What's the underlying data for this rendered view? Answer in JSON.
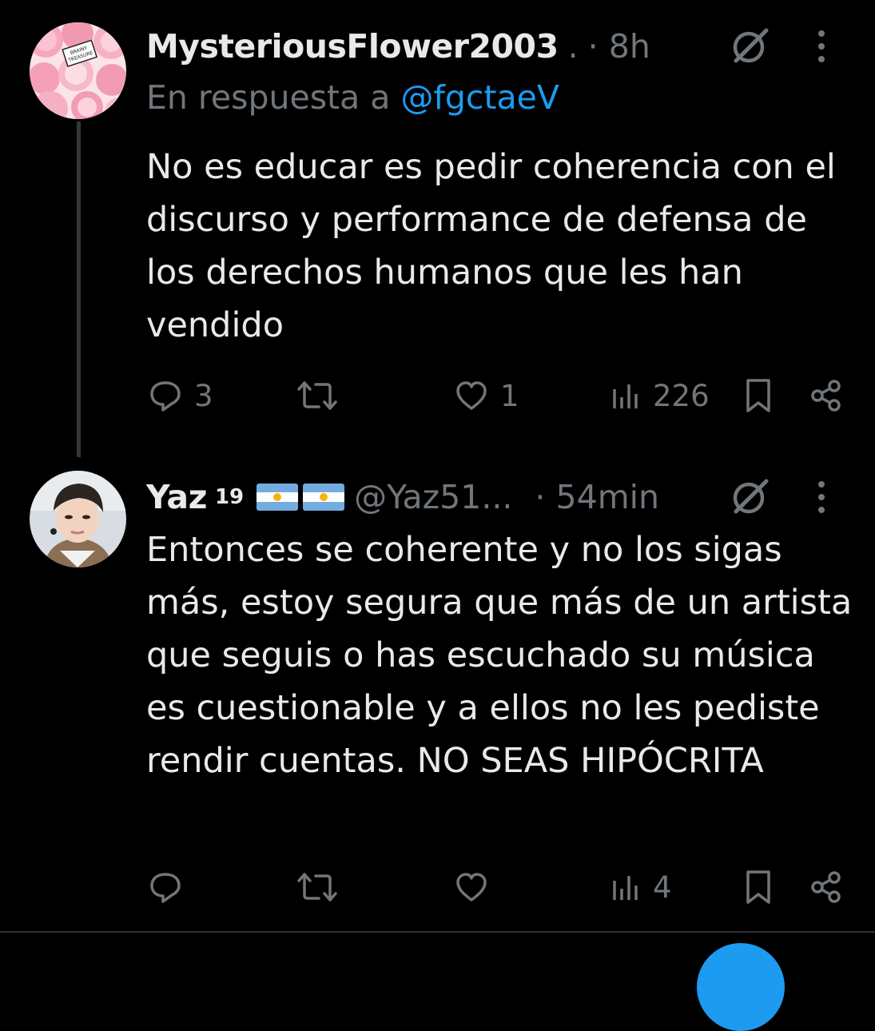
{
  "tweets": [
    {
      "display_name": "MysteriousFlower2003",
      "ellipsis": ".",
      "time": "· 8h",
      "reply_prefix": "En respuesta a",
      "reply_handle": "@fgctaeV",
      "text": "No es educar es pedir coherencia con el discurso y performance de defensa de los derechos humanos que les han vendido",
      "replies": "3",
      "retweets": "",
      "likes": "1",
      "views": "226",
      "avatar_text": "BRAINY\nDOUBLE\nTREASURE"
    },
    {
      "display_name": "Yaz",
      "superscript": "19",
      "handle": "@Yaz51...",
      "time": "· 54min",
      "text": "Entonces se coherente y no los sigas más, estoy segura que más de un artista que seguis o has escuchado su música es cuestionable y a ellos no les pediste rendir cuentas. NO SEAS HIPÓCRITA",
      "replies": "",
      "retweets": "",
      "likes": "",
      "views": "4"
    }
  ],
  "colors": {
    "background": "#000000",
    "text": "#e7e9ea",
    "muted": "#71767b",
    "link": "#1d9bf0",
    "argentina_blue": "#74acdf"
  },
  "icons": [
    "reply-icon",
    "retweet-icon",
    "like-icon",
    "views-icon",
    "bookmark-icon",
    "share-icon",
    "grok-icon",
    "more-icon"
  ]
}
